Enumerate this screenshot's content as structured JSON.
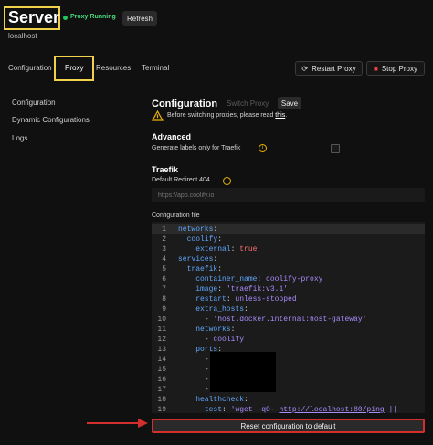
{
  "header": {
    "title": "Server",
    "status": "Proxy Running",
    "refresh_label": "Refresh",
    "subtitle": "localhost"
  },
  "tabs": [
    {
      "label": "Configuration"
    },
    {
      "label": "Proxy"
    },
    {
      "label": "Resources"
    },
    {
      "label": "Terminal"
    }
  ],
  "actions": {
    "restart_label": "Restart Proxy",
    "stop_label": "Stop Proxy"
  },
  "sidebar": {
    "items": [
      {
        "label": "Configuration"
      },
      {
        "label": "Dynamic Configurations"
      },
      {
        "label": "Logs"
      }
    ]
  },
  "config": {
    "heading": "Configuration",
    "switch_proxy_label": "Switch Proxy",
    "save_label": "Save",
    "warning_text": "Before switching proxies, please read ",
    "warning_link": "this",
    "warning_end": "."
  },
  "advanced": {
    "heading": "Advanced",
    "label": "Generate labels only for Traefik",
    "checked": false
  },
  "traefik": {
    "heading": "Traefik",
    "redirect_label": "Default Redirect 404",
    "redirect_placeholder": "https://app.coolify.io"
  },
  "config_file": {
    "label": "Configuration file",
    "lines": [
      {
        "n": "1",
        "text": "networks:"
      },
      {
        "n": "2",
        "text": "  coolify:"
      },
      {
        "n": "3",
        "text": "    external: true"
      },
      {
        "n": "4",
        "text": "services:"
      },
      {
        "n": "5",
        "text": "  traefik:"
      },
      {
        "n": "6",
        "text": "    container_name: coolify-proxy"
      },
      {
        "n": "7",
        "text": "    image: 'traefik:v3.1'"
      },
      {
        "n": "8",
        "text": "    restart: unless-stopped"
      },
      {
        "n": "9",
        "text": "    extra_hosts:"
      },
      {
        "n": "10",
        "text": "      - 'host.docker.internal:host-gateway'"
      },
      {
        "n": "11",
        "text": "    networks:"
      },
      {
        "n": "12",
        "text": "      - coolify"
      },
      {
        "n": "13",
        "text": "    ports:"
      },
      {
        "n": "14",
        "text": "      -"
      },
      {
        "n": "15",
        "text": "      -"
      },
      {
        "n": "16",
        "text": "      -"
      },
      {
        "n": "17",
        "text": "      -"
      },
      {
        "n": "18",
        "text": "    healthcheck:"
      },
      {
        "n": "19",
        "text": "      test: 'wget -qO- http://localhost:80/ping ||"
      }
    ]
  },
  "reset_label": "Reset configuration to default",
  "colors": {
    "accent_green": "#22c55e",
    "highlight_yellow": "#f0d24a",
    "annotation_red": "#d32f2f",
    "stop_red": "#ef4444",
    "warning_yellow": "#eab308"
  }
}
